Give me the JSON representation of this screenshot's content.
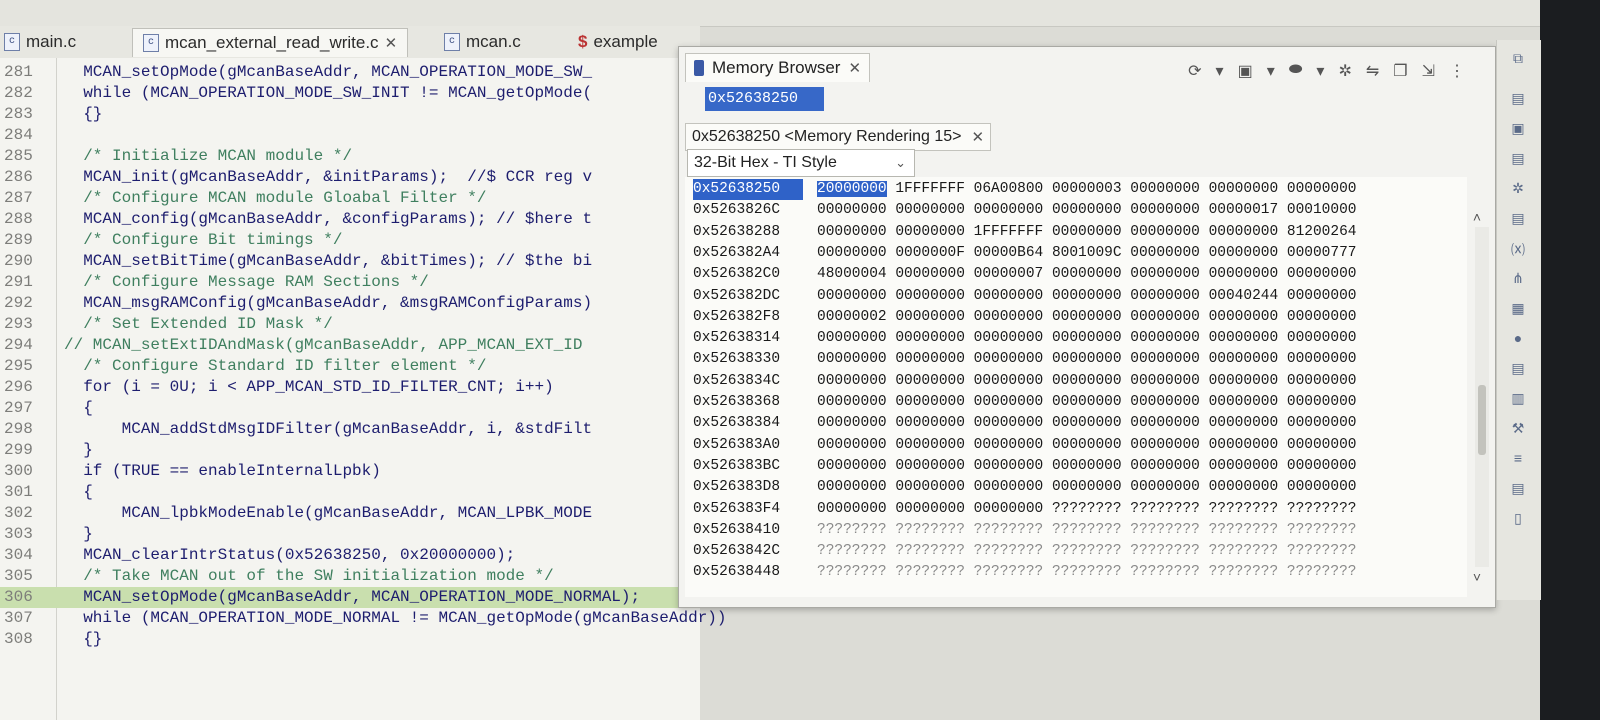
{
  "editor_tabs": [
    {
      "label": "main.c",
      "icon": "c-file-icon"
    },
    {
      "label": "mcan_external_read_write.c",
      "icon": "c-file-icon",
      "close": "✕"
    },
    {
      "label": "mcan.c",
      "icon": "c-file-icon"
    },
    {
      "label": "example",
      "icon": "dollar-file-icon"
    }
  ],
  "code_lines": [
    {
      "num": "281",
      "text": "  MCAN_setOpMode(gMcanBaseAddr, MCAN_OPERATION_MODE_SW_"
    },
    {
      "num": "282",
      "text": "  while (MCAN_OPERATION_MODE_SW_INIT != MCAN_getOpMode("
    },
    {
      "num": "283",
      "text": "  {}"
    },
    {
      "num": "284",
      "text": ""
    },
    {
      "num": "285",
      "text": "  /* Initialize MCAN module */"
    },
    {
      "num": "286",
      "text": "  MCAN_init(gMcanBaseAddr, &initParams);  //$ CCR reg v"
    },
    {
      "num": "287",
      "text": "  /* Configure MCAN module Gloabal Filter */"
    },
    {
      "num": "288",
      "text": "  MCAN_config(gMcanBaseAddr, &configParams); // $here t"
    },
    {
      "num": "289",
      "text": "  /* Configure Bit timings */"
    },
    {
      "num": "290",
      "text": "  MCAN_setBitTime(gMcanBaseAddr, &bitTimes); // $the bi"
    },
    {
      "num": "291",
      "text": "  /* Configure Message RAM Sections */"
    },
    {
      "num": "292",
      "text": "  MCAN_msgRAMConfig(gMcanBaseAddr, &msgRAMConfigParams)"
    },
    {
      "num": "293",
      "text": "  /* Set Extended ID Mask */"
    },
    {
      "num": "294",
      "text": "// MCAN_setExtIDAndMask(gMcanBaseAddr, APP_MCAN_EXT_ID"
    },
    {
      "num": "295",
      "text": "  /* Configure Standard ID filter element */"
    },
    {
      "num": "296",
      "text": "  for (i = 0U; i < APP_MCAN_STD_ID_FILTER_CNT; i++)"
    },
    {
      "num": "297",
      "text": "  {"
    },
    {
      "num": "298",
      "text": "      MCAN_addStdMsgIDFilter(gMcanBaseAddr, i, &stdFilt"
    },
    {
      "num": "299",
      "text": "  }"
    },
    {
      "num": "300",
      "text": "  if (TRUE == enableInternalLpbk)"
    },
    {
      "num": "301",
      "text": "  {"
    },
    {
      "num": "302",
      "text": "      MCAN_lpbkModeEnable(gMcanBaseAddr, MCAN_LPBK_MODE"
    },
    {
      "num": "303",
      "text": "  }"
    },
    {
      "num": "304",
      "text": "  MCAN_clearIntrStatus(0x52638250, 0x20000000);"
    },
    {
      "num": "305",
      "text": "  /* Take MCAN out of the SW initialization mode */"
    },
    {
      "num": "306",
      "text": "  MCAN_setOpMode(gMcanBaseAddr, MCAN_OPERATION_MODE_NORMAL);"
    },
    {
      "num": "307",
      "text": "  while (MCAN_OPERATION_MODE_NORMAL != MCAN_getOpMode(gMcanBaseAddr))"
    },
    {
      "num": "308",
      "text": "  {}"
    }
  ],
  "memory_browser": {
    "title": "Memory Browser",
    "close": "✕",
    "address_input": "0x52638250",
    "rendering_tab": "0x52638250 <Memory Rendering 15>",
    "rendering_close": "✕",
    "format": "32-Bit Hex - TI Style",
    "rows": [
      {
        "addr": "0x52638250",
        "values": "20000000 1FFFFFFF 06A00800 00000003 00000000 00000000 00000000"
      },
      {
        "addr": "0x5263826C",
        "values": "00000000 00000000 00000000 00000000 00000000 00000017 00010000"
      },
      {
        "addr": "0x52638288",
        "values": "00000000 00000000 1FFFFFFF 00000000 00000000 00000000 81200264"
      },
      {
        "addr": "0x526382A4",
        "values": "00000000 0000000F 00000B64 8001009C 00000000 00000000 00000777"
      },
      {
        "addr": "0x526382C0",
        "values": "48000004 00000000 00000007 00000000 00000000 00000000 00000000"
      },
      {
        "addr": "0x526382DC",
        "values": "00000000 00000000 00000000 00000000 00000000 00040244 00000000"
      },
      {
        "addr": "0x526382F8",
        "values": "00000002 00000000 00000000 00000000 00000000 00000000 00000000"
      },
      {
        "addr": "0x52638314",
        "values": "00000000 00000000 00000000 00000000 00000000 00000000 00000000"
      },
      {
        "addr": "0x52638330",
        "values": "00000000 00000000 00000000 00000000 00000000 00000000 00000000"
      },
      {
        "addr": "0x5263834C",
        "values": "00000000 00000000 00000000 00000000 00000000 00000000 00000000"
      },
      {
        "addr": "0x52638368",
        "values": "00000000 00000000 00000000 00000000 00000000 00000000 00000000"
      },
      {
        "addr": "0x52638384",
        "values": "00000000 00000000 00000000 00000000 00000000 00000000 00000000"
      },
      {
        "addr": "0x526383A0",
        "values": "00000000 00000000 00000000 00000000 00000000 00000000 00000000"
      },
      {
        "addr": "0x526383BC",
        "values": "00000000 00000000 00000000 00000000 00000000 00000000 00000000"
      },
      {
        "addr": "0x526383D8",
        "values": "00000000 00000000 00000000 00000000 00000000 00000000 00000000"
      },
      {
        "addr": "0x526383F4",
        "values": "00000000 00000000 00000000 ???????? ???????? ???????? ????????"
      },
      {
        "addr": "0x52638410",
        "values": "???????? ???????? ???????? ???????? ???????? ???????? ????????"
      },
      {
        "addr": "0x5263842C",
        "values": "???????? ???????? ???????? ???????? ???????? ???????? ????????"
      },
      {
        "addr": "0x52638448",
        "values": "???????? ???????? ???????? ???????? ???????? ???????? ????????"
      }
    ]
  },
  "colors": {
    "selection": "#2f62c8",
    "line_highlight": "#c9dfae",
    "comment": "#3f7f5f",
    "code": "#1d1d6e"
  },
  "icons": [
    "search-icon",
    "memory-browser-icon",
    "toolbar-icons",
    "chevron-down-icon",
    "scroll-up-icon",
    "scroll-down-icon"
  ]
}
